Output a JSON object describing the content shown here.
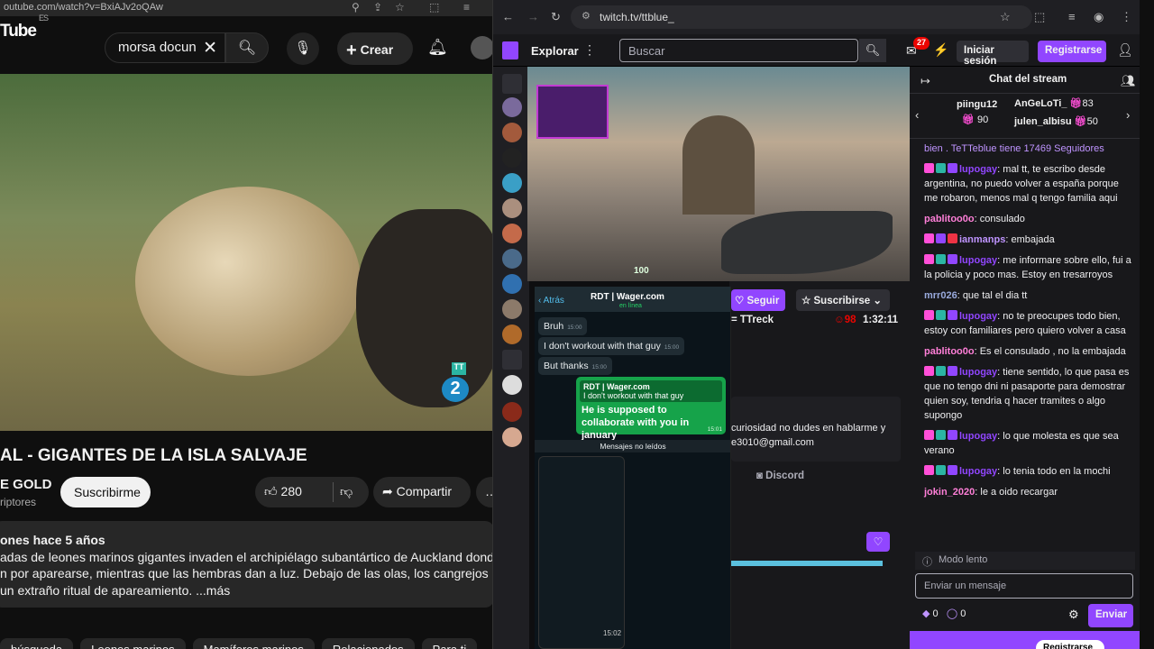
{
  "youtube": {
    "url": "outube.com/watch?v=BxiAJv2oQAw",
    "logo": "Tube",
    "logo_region": "ES",
    "search_value": "morsa docun",
    "create_label": "Crear",
    "video_badge_tag": "TT",
    "video_badge_number": "2",
    "title": "AL - GIGANTES DE LA ISLA SALVAJE",
    "channel": "E GOLD",
    "subs_label": "riptores",
    "subscribe_label": "Suscribirme",
    "likes": "280",
    "share_label": "Compartir",
    "desc_meta": "ones  hace 5 años",
    "desc_lines": [
      "adas de leones marinos gigantes invaden el archipiélago subantártico de Auckland donde los",
      "n por aparearse, mientras que las hembras dan a luz. Debajo de las olas, los cangrejos araña",
      "un extraño ritual de apareamiento. ...más"
    ],
    "chips": [
      "búsqueda",
      "Leones marinos",
      "Mamíferos marinos",
      "Relacionados",
      "Para ti"
    ]
  },
  "browser": {
    "url": "twitch.tv/ttblue_"
  },
  "twitch": {
    "explore": "Explorar",
    "search_placeholder": "Buscar",
    "notif_count": "27",
    "login": "Iniciar sesión",
    "register": "Registrarse",
    "follow": "Seguir",
    "subscribe": "Suscribirse",
    "streamer_frag": "= TTreck",
    "viewers": "98",
    "uptime": "1:32:11",
    "hud_health": "100",
    "about_lines": [
      "curiosidad no dudes en hablarme y",
      "e3010@gmail.com"
    ],
    "social_frag": "r",
    "discord": "Discord",
    "colors": {
      "purple": "#9146ff",
      "live_red": "#eb0400"
    }
  },
  "whatsapp": {
    "back": "Atrás",
    "contact": "RDT | Wager.com",
    "status": "en línea",
    "messages": [
      {
        "text": "Bruh",
        "time": "15:00"
      },
      {
        "text": "I don't workout with that guy",
        "time": "15:00"
      },
      {
        "text": "But thanks",
        "time": "15:00"
      }
    ],
    "quote_name": "RDT | Wager.com",
    "quote_text": "I don't workout with that guy",
    "out_text": "He is supposed to collaborate with you in january",
    "out_time": "15:01",
    "unread": "Mensajes no leídos",
    "phone_time": "15:02"
  },
  "chat": {
    "title": "Chat del stream",
    "gifts": [
      {
        "name": "piingu12",
        "count": "90"
      },
      {
        "name": "AnGeLoTi_",
        "count": "83"
      },
      {
        "name": "julen_albisu",
        "count": "50"
      }
    ],
    "lines": [
      {
        "user": "",
        "text": "bien . TeTTeblue tiene 17469 Seguidores"
      },
      {
        "user": "lupogay",
        "text": ": mal tt, te escribo desde argentina, no puedo volver a españa porque me robaron, menos mal q tengo familia aqui"
      },
      {
        "user": "pablitoo0o",
        "text": ": consulado"
      },
      {
        "user": "ianmanps",
        "text": ": embajada"
      },
      {
        "user": "lupogay",
        "text": ": me informare sobre ello, fui a la policia y poco mas. Estoy en tresarroyos"
      },
      {
        "user": "mrr026",
        "text": ": que tal el dia tt"
      },
      {
        "user": "lupogay",
        "text": ": no te preocupes todo bien, estoy con familiares pero quiero volver a casa"
      },
      {
        "user": "pablitoo0o",
        "text": ": Es el consulado , no la embajada"
      },
      {
        "user": "lupogay",
        "text": ": tiene sentido, lo que pasa es que no tengo dni ni pasaporte para demostrar quien soy, tendria q hacer tramites o algo supongo"
      },
      {
        "user": "lupogay",
        "text": ": lo que molesta es que sea verano"
      },
      {
        "user": "lupogay",
        "text": ": lo tenia todo en la mochi"
      },
      {
        "user": "jokin_2020",
        "text": ": le a oido recargar"
      }
    ],
    "slow_mode": "Modo lento",
    "input_placeholder": "Enviar un mensaje",
    "points_a": "0",
    "points_b": "0",
    "send": "Enviar",
    "register_bottom": "Registrarse"
  }
}
